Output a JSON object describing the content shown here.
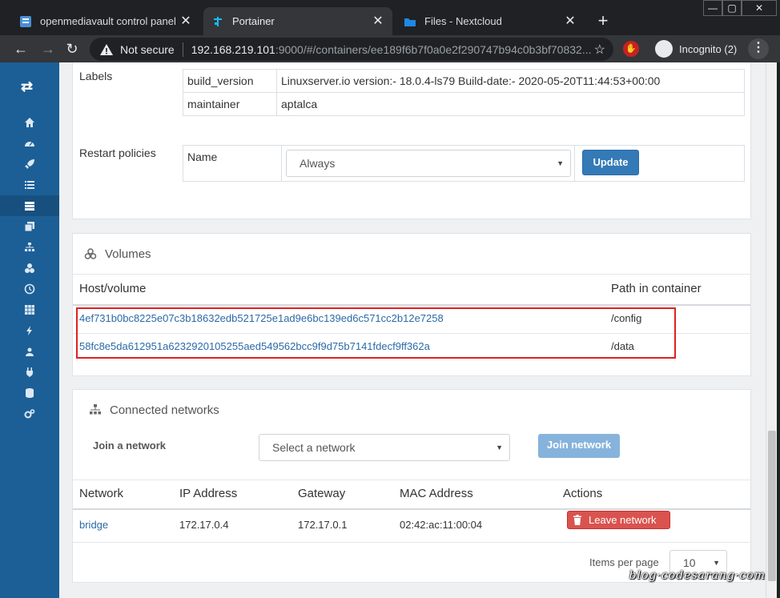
{
  "browser": {
    "tabs": [
      {
        "title": "openmediavault control panel - ",
        "close": "✕"
      },
      {
        "title": "Portainer",
        "close": "✕"
      },
      {
        "title": "Files - Nextcloud",
        "close": "✕"
      }
    ],
    "new_tab": "+",
    "window_controls": {
      "minimize": "—",
      "maximize": "▢",
      "close": "✕"
    },
    "address": {
      "security_label": "Not secure",
      "host": "192.168.219.101",
      "rest": ":9000/#/containers/ee189f6b7f0a0e2f290747b94c0b3bf70832..."
    },
    "incognito_label": "Incognito (2)",
    "icons": {
      "back": "back-icon",
      "forward": "forward-icon",
      "reload": "reload-icon",
      "star": "star-icon",
      "menu": "kebab-menu-icon"
    }
  },
  "sidebar": {
    "items": [
      "home-icon",
      "dashboard-icon",
      "rocket-icon",
      "list-icon",
      "containers-icon",
      "images-icon",
      "networks-icon",
      "volumes-icon",
      "history-icon",
      "grid-icon",
      "bolt-icon",
      "users-icon",
      "plug-icon",
      "database-icon",
      "cogs-icon"
    ],
    "active_index": 4
  },
  "labels_section": {
    "title": "Labels",
    "rows": [
      {
        "key": "build_version",
        "value": "Linuxserver.io version:- 18.0.4-ls79 Build-date:- 2020-05-20T11:44:53+00:00"
      },
      {
        "key": "maintainer",
        "value": "aptalca"
      }
    ]
  },
  "restart_section": {
    "title": "Restart policies",
    "name_label": "Name",
    "selected_policy": "Always",
    "update_button": "Update"
  },
  "volumes": {
    "title": "Volumes",
    "headers": {
      "host": "Host/volume",
      "path": "Path in container"
    },
    "rows": [
      {
        "host": "4ef731b0bc8225e07c3b18632edb521725e1ad9e6bc139ed6c571cc2b12e7258",
        "path": "/config"
      },
      {
        "host": "58fc8e5da612951a6232920105255aed549562bcc9f9d75b7141fdecf9ff362a",
        "path": "/data"
      }
    ]
  },
  "networks": {
    "title": "Connected networks",
    "join_label": "Join a network",
    "select_placeholder": "Select a network",
    "join_button": "Join network",
    "headers": [
      "Network",
      "IP Address",
      "Gateway",
      "MAC Address",
      "Actions"
    ],
    "rows": [
      {
        "network": "bridge",
        "ip": "172.17.0.4",
        "gateway": "172.17.0.1",
        "mac": "02:42:ac:11:00:04",
        "action": "Leave network"
      }
    ],
    "items_per_page_label": "Items per page",
    "items_per_page": "10"
  },
  "watermark": "blog·codesarang·com",
  "colors": {
    "sidebar": "#1c5f96",
    "primary": "#337ab7",
    "danger": "#d9534f",
    "highlight": "#e02020"
  }
}
